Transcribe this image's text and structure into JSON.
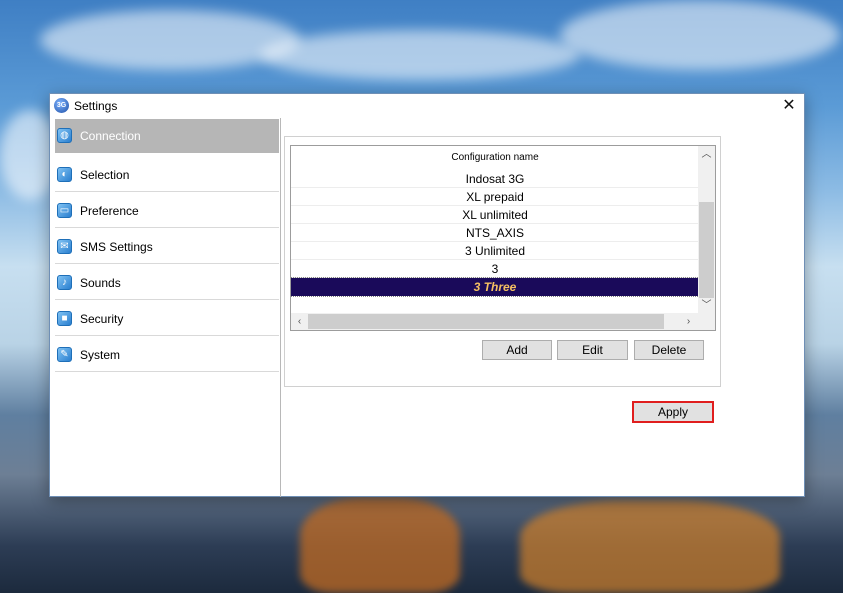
{
  "window": {
    "title": "Settings",
    "app_icon_text": "3G",
    "close_glyph": "✕"
  },
  "sidebar": {
    "items": [
      {
        "label": "Connection",
        "icon": "globe-icon",
        "active": true
      },
      {
        "label": "Selection",
        "icon": "selection-icon"
      },
      {
        "label": "Preference",
        "icon": "monitor-icon"
      },
      {
        "label": "SMS Settings",
        "icon": "envelope-icon"
      },
      {
        "label": "Sounds",
        "icon": "speaker-icon"
      },
      {
        "label": "Security",
        "icon": "lock-icon"
      },
      {
        "label": "System",
        "icon": "tools-icon"
      }
    ]
  },
  "config_list": {
    "header": "Configuration name",
    "rows": [
      "Indosat 3G",
      "XL prepaid",
      "XL unlimited",
      "NTS_AXIS",
      "3 Unlimited",
      "3",
      "3 Three"
    ],
    "selected_row": "3 Three"
  },
  "buttons": {
    "add": "Add",
    "edit": "Edit",
    "delete": "Delete",
    "apply": "Apply"
  },
  "colors": {
    "selected_row_bg": "#1a0a5a",
    "selected_row_text": "#f5c062",
    "apply_highlight": "#e01e1e"
  }
}
